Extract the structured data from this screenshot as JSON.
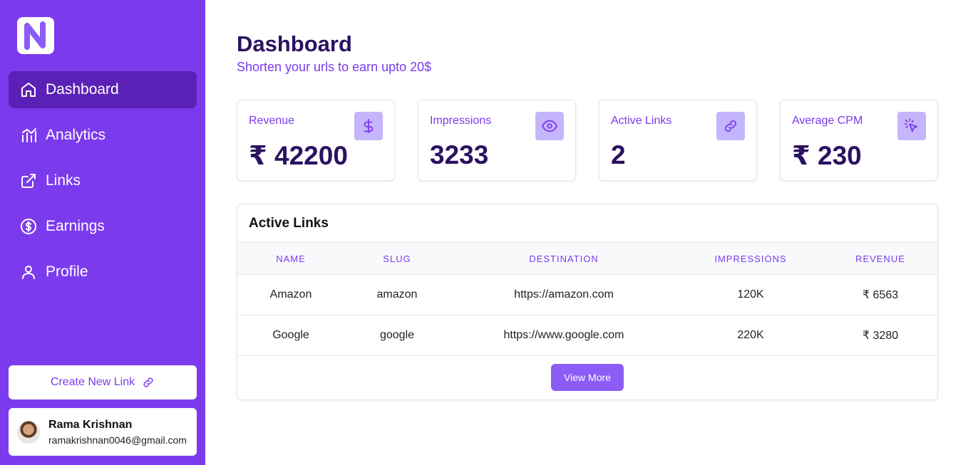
{
  "brand": {
    "logo_letter": "N"
  },
  "sidebar": {
    "items": [
      {
        "label": "Dashboard",
        "icon": "home-icon",
        "active": true
      },
      {
        "label": "Analytics",
        "icon": "analytics-icon",
        "active": false
      },
      {
        "label": "Links",
        "icon": "external-link-icon",
        "active": false
      },
      {
        "label": "Earnings",
        "icon": "dollar-circle-icon",
        "active": false
      },
      {
        "label": "Profile",
        "icon": "user-icon",
        "active": false
      }
    ],
    "create_button": "Create New Link",
    "user": {
      "name": "Rama Krishnan",
      "email": "ramakrishnan0046@gmail.com"
    }
  },
  "header": {
    "title": "Dashboard",
    "subtitle": "Shorten your urls to earn upto 20$"
  },
  "stats": [
    {
      "label": "Revenue",
      "value": "₹ 42200",
      "icon": "dollar-icon"
    },
    {
      "label": "Impressions",
      "value": "3233",
      "icon": "eye-icon"
    },
    {
      "label": "Active Links",
      "value": "2",
      "icon": "link-icon"
    },
    {
      "label": "Average CPM",
      "value": "₹ 230",
      "icon": "cursor-click-icon"
    }
  ],
  "active_links": {
    "title": "Active Links",
    "columns": [
      "NAME",
      "SLUG",
      "DESTINATION",
      "IMPRESSIONS",
      "REVENUE"
    ],
    "rows": [
      [
        "Amazon",
        "amazon",
        "https://amazon.com",
        "120K",
        "₹ 6563"
      ],
      [
        "Google",
        "google",
        "https://www.google.com",
        "220K",
        "₹ 3280"
      ]
    ],
    "view_more": "View More"
  },
  "colors": {
    "primary": "#7c3aed",
    "primary_dark": "#5b21b6",
    "icon_bg": "#c4b5fd",
    "text_dark": "#2a1261"
  }
}
